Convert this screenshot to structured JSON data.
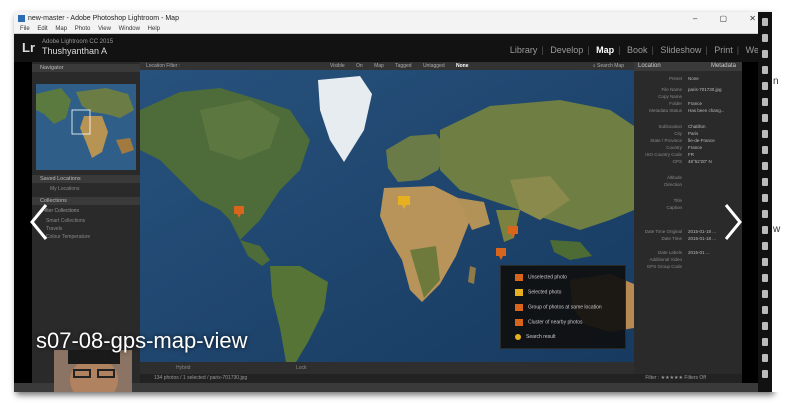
{
  "window": {
    "title": "new-master - Adobe Photoshop Lightroom - Map",
    "menu": [
      "File",
      "Edit",
      "Map",
      "Photo",
      "View",
      "Window",
      "Help"
    ],
    "controls": "–  ▢  ✕"
  },
  "identity": {
    "logo": "Lr",
    "catalog": "Adobe Lightroom CC 2015",
    "user": "Thushyanthan A"
  },
  "modules": [
    {
      "label": "Library",
      "active": false
    },
    {
      "label": "Develop",
      "active": false
    },
    {
      "label": "Map",
      "active": true
    },
    {
      "label": "Book",
      "active": false
    },
    {
      "label": "Slideshow",
      "active": false
    },
    {
      "label": "Print",
      "active": false
    },
    {
      "label": "Web",
      "active": false
    }
  ],
  "left_panel": {
    "navigator": "Navigator",
    "saved_locations": "Saved Locations",
    "my_locations": "My Locations",
    "collections": "Collections",
    "filter": "Filter Collections",
    "items": [
      "Smart Collections",
      "Travels",
      "Colour Temperature"
    ]
  },
  "map_filter": {
    "label": "Location Filter :",
    "options": [
      "Visible On Map",
      "Tagged",
      "Untagged"
    ],
    "active": "None",
    "search": "Search Map"
  },
  "legend": [
    {
      "label": "Unselected photo",
      "color": "#d9641c"
    },
    {
      "label": "Selected photo",
      "color": "#e6b021"
    },
    {
      "label": "Group of photos at same location",
      "color": "#d9641c"
    },
    {
      "label": "Cluster of nearby photos",
      "color": "#d9641c"
    },
    {
      "label": "Search result",
      "color": "#e6b021"
    }
  ],
  "right_panel": {
    "location_label": "Location",
    "metadata_label": "Metadata",
    "preset_key": "Preset",
    "preset_value": "None",
    "rows": [
      {
        "k": "File Name",
        "v": "paris-701730.jpg"
      },
      {
        "k": "Copy Name",
        "v": ""
      },
      {
        "k": "Folder",
        "v": "France"
      },
      {
        "k": "Metadata Status",
        "v": "Has been chang..."
      },
      {
        "k": "Sublocation",
        "v": "Chatillon"
      },
      {
        "k": "City",
        "v": "Paris"
      },
      {
        "k": "State / Province",
        "v": "Île-de-France"
      },
      {
        "k": "Country",
        "v": "France"
      },
      {
        "k": "ISO Country Code",
        "v": "FR"
      },
      {
        "k": "GPS",
        "v": "48°52'20\" N"
      },
      {
        "k": "Altitude",
        "v": ""
      },
      {
        "k": "Direction",
        "v": ""
      },
      {
        "k": "Title",
        "v": ""
      },
      {
        "k": "Caption",
        "v": ""
      },
      {
        "k": "Date Time Original",
        "v": "2015-01-18 ..."
      },
      {
        "k": "Date Time",
        "v": "2015-01-18 ..."
      },
      {
        "k": "Date Labels",
        "v": "2015-01 ..."
      },
      {
        "k": "Additional Video",
        "v": ""
      },
      {
        "k": "GPS Group Code",
        "v": ""
      }
    ]
  },
  "bottom": {
    "map_style": "Hybrid",
    "lock": "Lock",
    "filmstrip": "134 photos / 1 selected / paris-701730.jpg",
    "filter_label": "Filter :",
    "filter_value": "Filters Off"
  },
  "overlay": {
    "watermark": "s07-08-gps-map-view"
  },
  "right_clip": {
    "a": "n",
    "b": "w"
  }
}
